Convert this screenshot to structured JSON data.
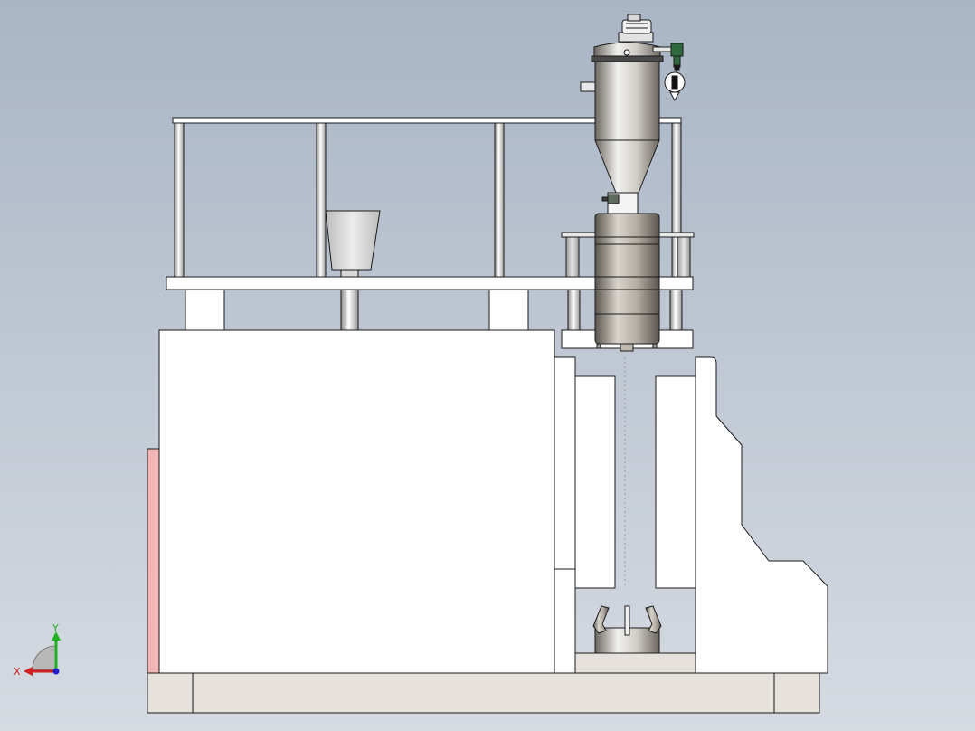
{
  "viewport": {
    "background_top": "#a9b5c5",
    "background_bottom": "#d6dbe2"
  },
  "colors": {
    "part_fill": "#ffffff",
    "part_edge": "#1a1a1a",
    "steel_light": "#f1f1ef",
    "steel_mid": "#bdb8b0",
    "steel_dark": "#6b665f",
    "base_fill": "#e6e1dc",
    "highlight_side": "#f4b5b5",
    "valve_green": "#2f6a3e",
    "axis_x": "#d02020",
    "axis_y": "#20b020",
    "axis_z": "#2020d0"
  },
  "triad": {
    "x_label": "X",
    "y_label": "Y"
  }
}
